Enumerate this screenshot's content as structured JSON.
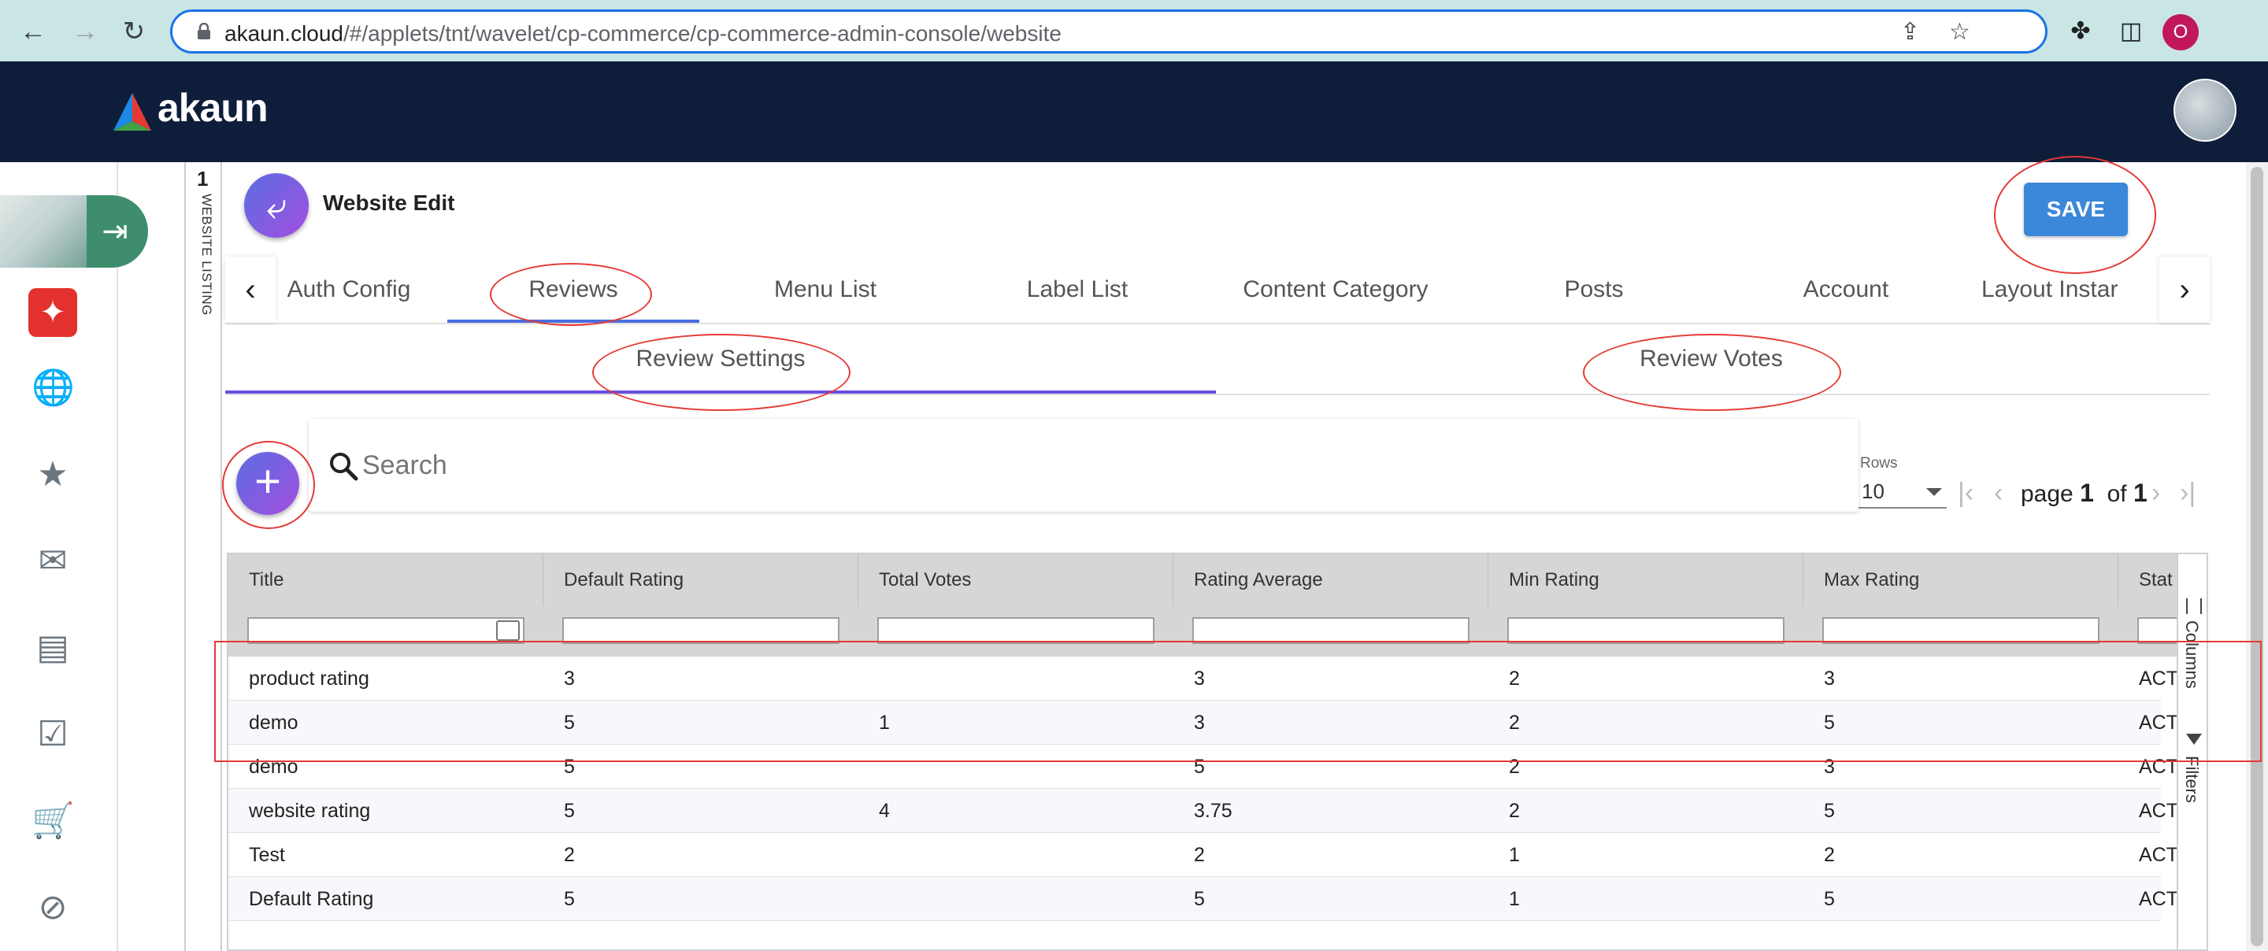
{
  "browser": {
    "url_host": "akaun.cloud",
    "url_path": "/#/applets/tnt/wavelet/cp-commerce/cp-commerce-admin-console/website",
    "profile_initial": "O"
  },
  "app": {
    "logo_text": "akaun"
  },
  "vertical_tab": {
    "number": "1",
    "label": "WEBSITE LISTING"
  },
  "page": {
    "title": "Website Edit",
    "save_label": "SAVE"
  },
  "tabs": [
    {
      "label": "Auth Config",
      "active": false
    },
    {
      "label": "Reviews",
      "active": true
    },
    {
      "label": "Menu List",
      "active": false
    },
    {
      "label": "Label List",
      "active": false
    },
    {
      "label": "Content Category",
      "active": false
    },
    {
      "label": "Posts",
      "active": false
    },
    {
      "label": "Account",
      "active": false
    },
    {
      "label": "Layout Instar",
      "active": false
    }
  ],
  "subtabs": [
    {
      "label": "Review Settings",
      "active": true
    },
    {
      "label": "Review Votes",
      "active": false
    }
  ],
  "search": {
    "placeholder": "Search"
  },
  "pagination": {
    "rows_label": "Rows",
    "rows_value": "10",
    "page_word": "page",
    "page_current": "1",
    "of_word": "of",
    "page_total": "1"
  },
  "grid": {
    "columns": [
      "Title",
      "Default Rating",
      "Total Votes",
      "Rating Average",
      "Min Rating",
      "Max Rating",
      "Stat"
    ],
    "rows": [
      [
        "product rating",
        "3",
        "",
        "3",
        "2",
        "3",
        "ACT"
      ],
      [
        "demo",
        "5",
        "1",
        "3",
        "2",
        "5",
        "ACT"
      ],
      [
        "demo",
        "5",
        "",
        "5",
        "2",
        "3",
        "ACT"
      ],
      [
        "website rating",
        "5",
        "4",
        "3.75",
        "2",
        "5",
        "ACT"
      ],
      [
        "Test",
        "2",
        "",
        "2",
        "1",
        "2",
        "ACT"
      ],
      [
        "Default Rating",
        "5",
        "",
        "5",
        "1",
        "5",
        "ACT"
      ]
    ],
    "side_panel": {
      "columns_label": "Columns",
      "filters_label": "Filters"
    }
  },
  "colors": {
    "browser_chrome": "#c9e6e4",
    "app_header": "#0e1e3a",
    "save_button": "#3b87d9",
    "annotation": "#e53935",
    "tab_indicator": "#4a6ee0"
  }
}
